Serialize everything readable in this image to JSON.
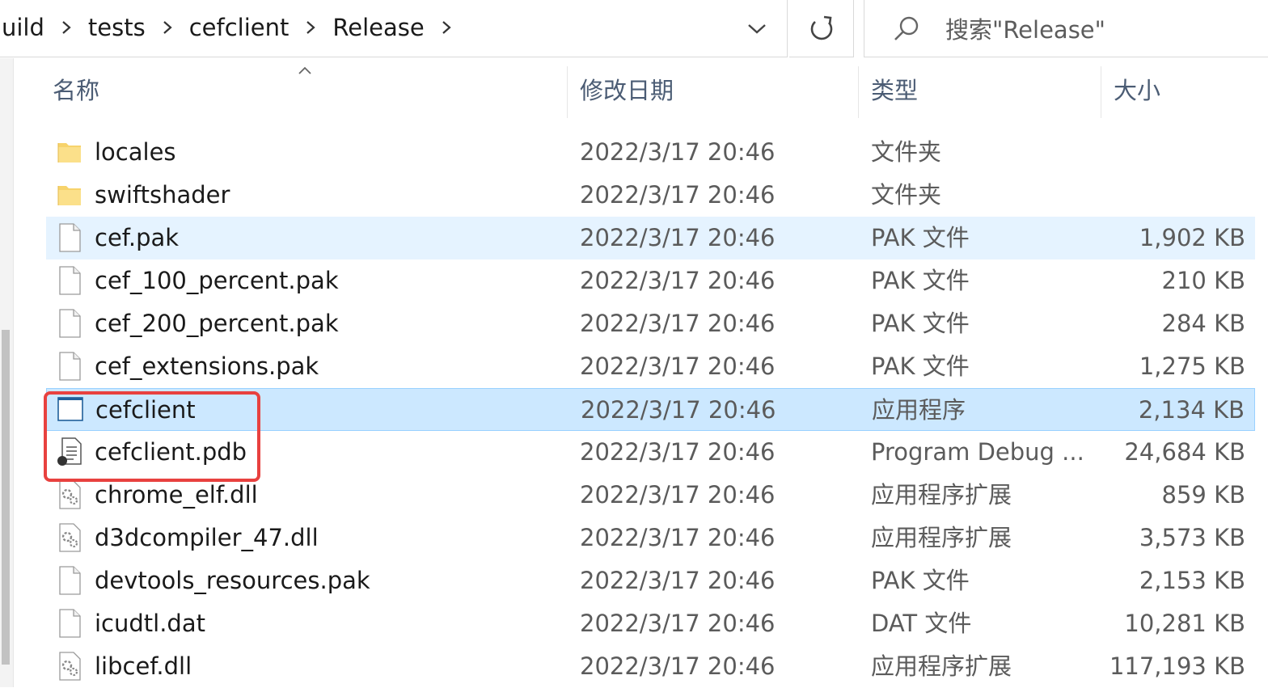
{
  "breadcrumb": {
    "items": [
      "uild",
      "tests",
      "cefclient",
      "Release"
    ]
  },
  "search": {
    "placeholder": "搜索\"Release\""
  },
  "columns": {
    "name": "名称",
    "date": "修改日期",
    "type": "类型",
    "size": "大小"
  },
  "files": [
    {
      "name": "locales",
      "date": "2022/3/17 20:46",
      "type": "文件夹",
      "size": "",
      "icon": "folder-icon",
      "state": "normal"
    },
    {
      "name": "swiftshader",
      "date": "2022/3/17 20:46",
      "type": "文件夹",
      "size": "",
      "icon": "folder-icon",
      "state": "normal"
    },
    {
      "name": "cef.pak",
      "date": "2022/3/17 20:46",
      "type": "PAK 文件",
      "size": "1,902 KB",
      "icon": "file-icon",
      "state": "hover"
    },
    {
      "name": "cef_100_percent.pak",
      "date": "2022/3/17 20:46",
      "type": "PAK 文件",
      "size": "210 KB",
      "icon": "file-icon",
      "state": "normal"
    },
    {
      "name": "cef_200_percent.pak",
      "date": "2022/3/17 20:46",
      "type": "PAK 文件",
      "size": "284 KB",
      "icon": "file-icon",
      "state": "normal"
    },
    {
      "name": "cef_extensions.pak",
      "date": "2022/3/17 20:46",
      "type": "PAK 文件",
      "size": "1,275 KB",
      "icon": "file-icon",
      "state": "normal"
    },
    {
      "name": "cefclient",
      "date": "2022/3/17 20:46",
      "type": "应用程序",
      "size": "2,134 KB",
      "icon": "app-icon",
      "state": "selected"
    },
    {
      "name": "cefclient.pdb",
      "date": "2022/3/17 20:46",
      "type": "Program Debug ...",
      "size": "24,684 KB",
      "icon": "pdb-icon",
      "state": "normal"
    },
    {
      "name": "chrome_elf.dll",
      "date": "2022/3/17 20:46",
      "type": "应用程序扩展",
      "size": "859 KB",
      "icon": "dll-icon",
      "state": "normal"
    },
    {
      "name": "d3dcompiler_47.dll",
      "date": "2022/3/17 20:46",
      "type": "应用程序扩展",
      "size": "3,573 KB",
      "icon": "dll-icon",
      "state": "normal"
    },
    {
      "name": "devtools_resources.pak",
      "date": "2022/3/17 20:46",
      "type": "PAK 文件",
      "size": "2,153 KB",
      "icon": "file-icon",
      "state": "normal"
    },
    {
      "name": "icudtl.dat",
      "date": "2022/3/17 20:46",
      "type": "DAT 文件",
      "size": "10,281 KB",
      "icon": "file-icon",
      "state": "normal"
    },
    {
      "name": "libcef.dll",
      "date": "2022/3/17 20:46",
      "type": "应用程序扩展",
      "size": "117,193 KB",
      "icon": "dll-icon",
      "state": "normal"
    }
  ],
  "colors": {
    "selected_bg": "#cce8ff",
    "hover_bg": "#e5f3ff",
    "annotation": "#e8413f"
  }
}
